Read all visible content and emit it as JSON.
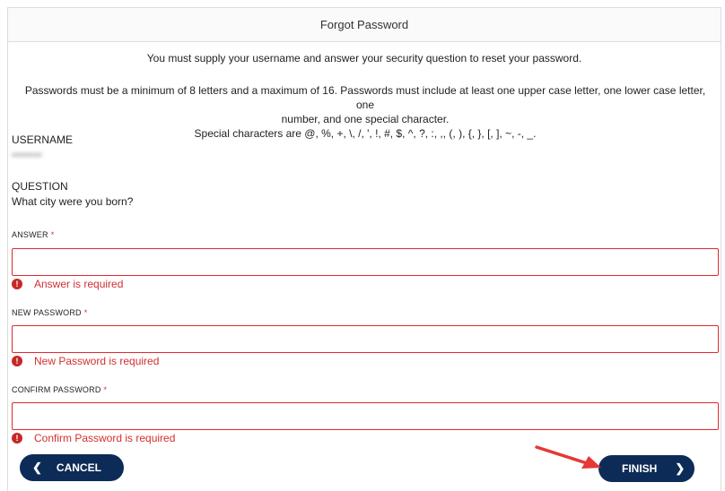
{
  "header": {
    "title": "Forgot Password"
  },
  "intro": "You must supply your username and answer your security question to reset your password.",
  "rules": {
    "line1": "Passwords must be a minimum of 8 letters and a maximum of 16. Passwords must include at least one upper case letter, one lower case letter, one",
    "line2": "number, and one special character.",
    "line3": "Special characters are @, %, +, \\, /, ', !, #, $, ^, ?, :, ,, (, ), {, }, [, ], ~, -, _."
  },
  "username": {
    "label": "USERNAME",
    "value": "••••••••"
  },
  "question": {
    "label": "QUESTION",
    "value": "What city were you born?"
  },
  "fields": {
    "answer": {
      "label": "ANSWER",
      "required_mark": "*",
      "value": "",
      "placeholder": "",
      "error": "Answer is required"
    },
    "new_password": {
      "label": "NEW PASSWORD",
      "required_mark": "*",
      "value": "",
      "placeholder": "",
      "error": "New Password is required"
    },
    "confirm_password": {
      "label": "CONFIRM PASSWORD",
      "required_mark": "*",
      "value": "",
      "placeholder": "",
      "error": "Confirm Password is required"
    }
  },
  "buttons": {
    "cancel": "CANCEL",
    "finish": "FINISH"
  },
  "icons": {
    "cancel": "chevron-left-icon",
    "finish": "chevron-right-icon",
    "error": "error-icon",
    "annotation": "red-arrow"
  },
  "colors": {
    "primary": "#0d2b57",
    "error": "#d32f2f",
    "annotation_arrow": "#e53935"
  }
}
